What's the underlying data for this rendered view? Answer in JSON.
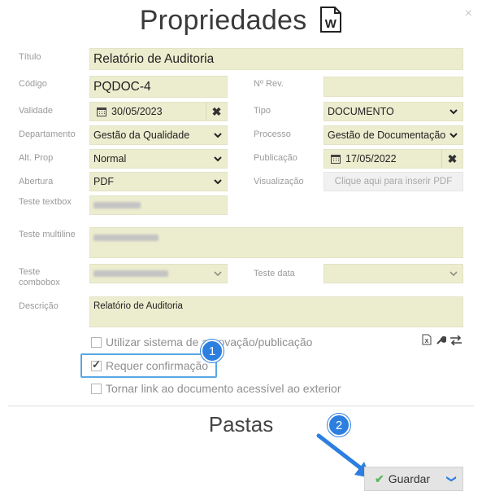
{
  "dialog": {
    "title": "Propriedades",
    "close_glyph": "×",
    "icons": {
      "title": "word-document-icon",
      "close": "close-icon"
    }
  },
  "labels": {
    "titulo": "Título",
    "codigo": "Código",
    "nrev": "Nº Rev.",
    "validade": "Validade",
    "tipo": "Tipo",
    "departamento": "Departamento",
    "processo": "Processo",
    "altprop": "Alt. Prop",
    "publicacao": "Publicação",
    "abertura": "Abertura",
    "visualizacao": "Visualização",
    "teste_textbox": "Teste textbox",
    "teste_multiline": "Teste multiline",
    "teste_combobox": "Teste combobox",
    "teste_data": "Teste data",
    "descricao": "Descrição"
  },
  "fields": {
    "titulo": "Relatório de Auditoria",
    "codigo": "PQDOC-4",
    "nrev": "",
    "validade": "30/05/2023",
    "tipo": "DOCUMENTO",
    "departamento": "Gestão da Qualidade",
    "processo": "Gestão de Documentação",
    "altprop": "Normal",
    "publicacao": "17/05/2022",
    "abertura": "PDF",
    "visualizacao_placeholder": "Clique aqui para inserir PDF",
    "teste_data": "",
    "descricao": "Relatório de Auditoria"
  },
  "checkboxes": {
    "utilizar": {
      "label": "Utilizar sistema de aprovação/publicação",
      "checked": false
    },
    "requer": {
      "label": "Requer confirmação",
      "checked": true
    },
    "tornar": {
      "label": "Tornar link ao documento acessível ao exterior",
      "checked": false
    }
  },
  "callouts": {
    "one": "1",
    "two": "2"
  },
  "section": {
    "pastas": "Pastas"
  },
  "save_button": {
    "label": "Guardar"
  },
  "colors": {
    "field_bg": "#ececcf",
    "accent": "#2d7fdf",
    "ok": "#5cb85c"
  }
}
